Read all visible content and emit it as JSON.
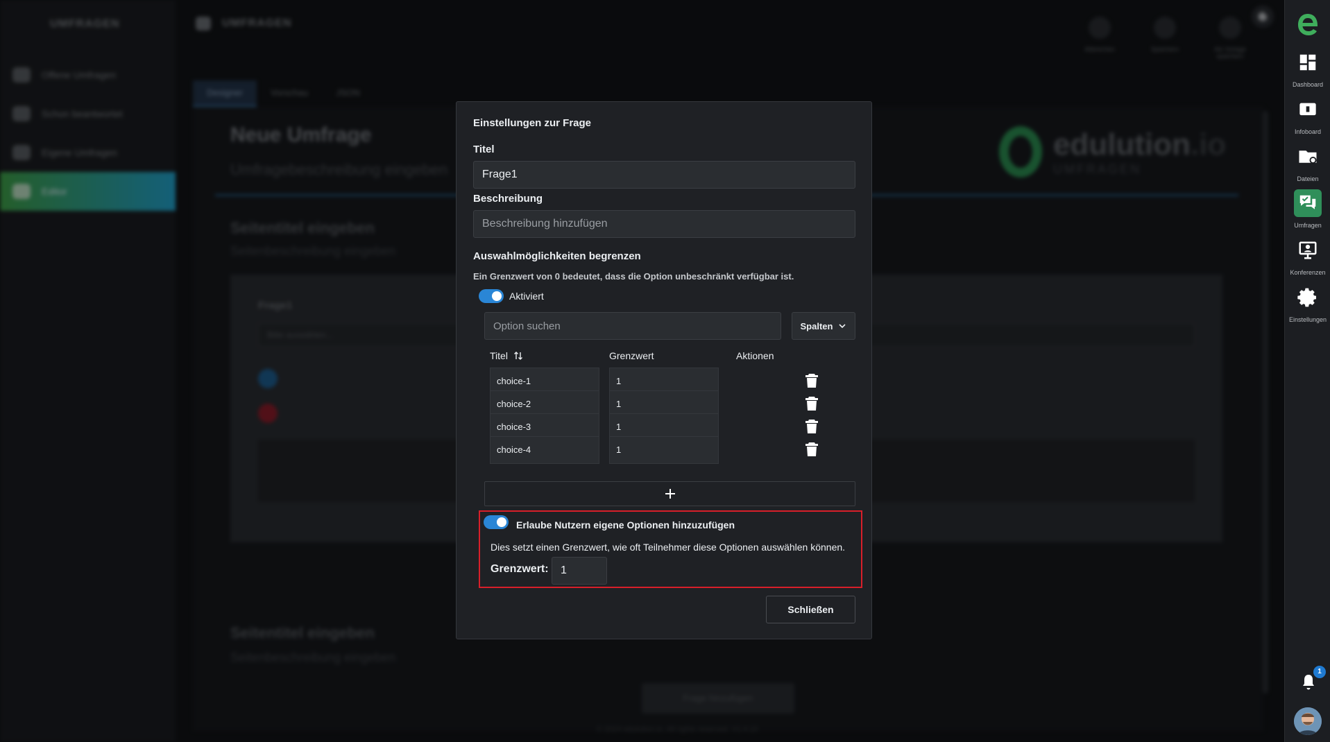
{
  "app": {
    "section_title": "UMFRAGEN",
    "top_title": "UMFRAGEN"
  },
  "left_sidebar": {
    "items": [
      {
        "label": "Offene Umfragen"
      },
      {
        "label": "Schon beantwortet"
      },
      {
        "label": "Eigene Umfragen"
      },
      {
        "label": "Editor",
        "active": true
      }
    ]
  },
  "top_actions": [
    {
      "label": "Abbrechen"
    },
    {
      "label": "Speichern"
    },
    {
      "label": "Als Vorlage speichern"
    }
  ],
  "editor_tabs": [
    "Designer",
    "Vorschau",
    "JSON"
  ],
  "survey": {
    "title": "Neue Umfrage",
    "description": "Umfragebeschreibung eingeben",
    "page_title": "Seitentitel eingeben",
    "page_description": "Seitenbeschreibung eingeben",
    "question_name": "Frage1",
    "select_placeholder": "Bitte auswählen...",
    "add_question": "Frage hinzufügen",
    "footer": "© 2024 edulution.io. All rights reserved. V1.4.10",
    "brand_name": "edulution",
    "brand_suffix": ".io",
    "brand_sub": "UMFRAGEN"
  },
  "right_rail": {
    "items": [
      {
        "label": "Dashboard",
        "icon": "dashboard-icon"
      },
      {
        "label": "Infoboard",
        "icon": "infoboard-icon"
      },
      {
        "label": "Dateien",
        "icon": "folder-icon"
      },
      {
        "label": "Umfragen",
        "icon": "surveys-icon",
        "active": true
      },
      {
        "label": "Konferenzen",
        "icon": "conference-icon"
      },
      {
        "label": "Einstellungen",
        "icon": "gear-icon"
      }
    ],
    "notification_count": "1"
  },
  "modal": {
    "heading": "Einstellungen zur Frage",
    "title_label": "Titel",
    "title_value": "Frage1",
    "description_label": "Beschreibung",
    "description_placeholder": "Beschreibung hinzufügen",
    "limit_section_title": "Auswahlmöglichkeiten begrenzen",
    "limit_hint": "Ein Grenzwert von 0 bedeutet, dass die Option unbeschränkt verfügbar ist.",
    "limit_toggle_label": "Aktiviert",
    "search_placeholder": "Option suchen",
    "columns_button": "Spalten",
    "table_headers": {
      "title": "Titel",
      "limit": "Grenzwert",
      "actions": "Aktionen"
    },
    "choices": [
      {
        "title": "choice-1",
        "limit": "1"
      },
      {
        "title": "choice-2",
        "limit": "1"
      },
      {
        "title": "choice-3",
        "limit": "1"
      },
      {
        "title": "choice-4",
        "limit": "1"
      }
    ],
    "add_row_symbol": "+",
    "custom_options_label": "Erlaube Nutzern eigene Optionen hinzuzufügen",
    "custom_options_hint": "Dies setzt einen Grenzwert, wie oft Teilnehmer diese Optionen auswählen können.",
    "custom_limit_label": "Grenzwert:",
    "custom_limit_value": "1",
    "close_button": "Schließen"
  },
  "colors": {
    "accent": "#2a86d6",
    "highlight_border": "#d81f2a",
    "active_green": "#2f8f5a"
  }
}
